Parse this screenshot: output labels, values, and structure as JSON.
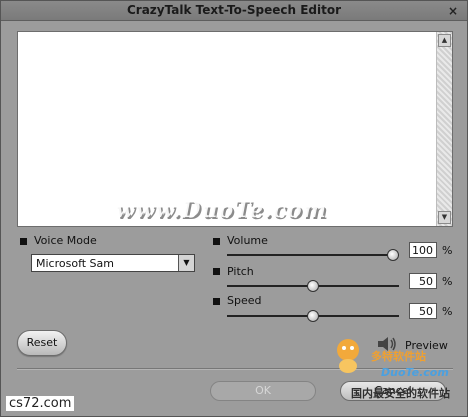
{
  "window": {
    "title": "CrazyTalk Text-To-Speech Editor",
    "close_glyph": "×"
  },
  "editor": {
    "text": ""
  },
  "voice": {
    "label": "Voice Mode",
    "selected": "Microsoft Sam"
  },
  "volume": {
    "label": "Volume",
    "value": "100",
    "unit": "%",
    "fraction": 1.0
  },
  "pitch": {
    "label": "Pitch",
    "value": "50",
    "unit": "%",
    "fraction": 0.5
  },
  "speed": {
    "label": "Speed",
    "value": "50",
    "unit": "%",
    "fraction": 0.5
  },
  "buttons": {
    "reset": "Reset",
    "preview": "Preview",
    "ok": "OK",
    "cancel": "Cancel"
  },
  "watermarks": {
    "center": "www.DuoTe.com",
    "logo_cn": "多特软件站",
    "logo_domain": "DuoTe.com",
    "logo_sub": "国内最安全的软件站",
    "site": "cs72.com"
  },
  "icons": {
    "speaker": "speaker-icon",
    "scroll_up": "scroll-up-icon",
    "scroll_down": "scroll-down-icon",
    "dropdown": "chevron-down-icon"
  }
}
